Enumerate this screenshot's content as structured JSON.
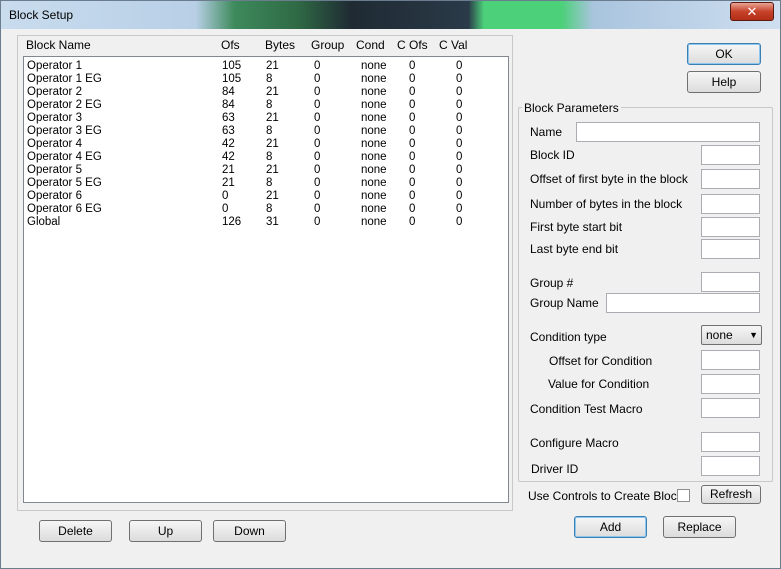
{
  "window": {
    "title": "Block Setup",
    "close_label": "✕"
  },
  "list": {
    "columns": [
      "Block Name",
      "Ofs",
      "Bytes",
      "Group",
      "Cond",
      "C Ofs",
      "C Val"
    ],
    "rows": [
      [
        "Operator 1",
        "105",
        "21",
        "0",
        "none",
        "0",
        "0"
      ],
      [
        "Operator 1 EG",
        "105",
        "8",
        "0",
        "none",
        "0",
        "0"
      ],
      [
        "Operator 2",
        "84",
        "21",
        "0",
        "none",
        "0",
        "0"
      ],
      [
        "Operator 2 EG",
        "84",
        "8",
        "0",
        "none",
        "0",
        "0"
      ],
      [
        "Operator 3",
        "63",
        "21",
        "0",
        "none",
        "0",
        "0"
      ],
      [
        "Operator 3 EG",
        "63",
        "8",
        "0",
        "none",
        "0",
        "0"
      ],
      [
        "Operator 4",
        "42",
        "21",
        "0",
        "none",
        "0",
        "0"
      ],
      [
        "Operator 4 EG",
        "42",
        "8",
        "0",
        "none",
        "0",
        "0"
      ],
      [
        "Operator 5",
        "21",
        "21",
        "0",
        "none",
        "0",
        "0"
      ],
      [
        "Operator 5 EG",
        "21",
        "8",
        "0",
        "none",
        "0",
        "0"
      ],
      [
        "Operator 6",
        "0",
        "21",
        "0",
        "none",
        "0",
        "0"
      ],
      [
        "Operator 6 EG",
        "0",
        "8",
        "0",
        "none",
        "0",
        "0"
      ],
      [
        "Global",
        "126",
        "31",
        "0",
        "none",
        "0",
        "0"
      ]
    ]
  },
  "buttons": {
    "ok": "OK",
    "help": "Help",
    "delete": "Delete",
    "up": "Up",
    "down": "Down",
    "refresh": "Refresh",
    "add": "Add",
    "replace": "Replace"
  },
  "params": {
    "title": "Block Parameters",
    "name": "Name",
    "block_id": "Block ID",
    "offset_first_byte": "Offset of first byte in the block",
    "num_bytes": "Number of bytes in the block",
    "first_byte_start_bit": "First byte start bit",
    "last_byte_end_bit": "Last byte end bit",
    "group_num": "Group #",
    "group_name": "Group Name",
    "condition_type": "Condition type",
    "condition_type_value": "none",
    "offset_for_condition": "Offset for Condition",
    "value_for_condition": "Value for Condition",
    "condition_test_macro": "Condition Test Macro",
    "configure_macro": "Configure Macro",
    "driver_id": "Driver ID",
    "use_controls": "Use Controls to Create Block"
  }
}
